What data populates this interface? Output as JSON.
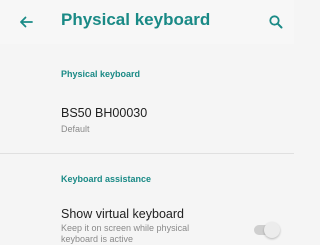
{
  "colors": {
    "accent": "#1a8a86",
    "background": "#f5f5f5",
    "primary_text": "#212121",
    "secondary_text": "#8a8a8a",
    "divider": "#e0e0e0"
  },
  "appbar": {
    "back_icon": "arrow-back-icon",
    "title": "Physical keyboard",
    "search_icon": "search-icon"
  },
  "sections": {
    "physical": {
      "header": "Physical keyboard",
      "device": {
        "title": "BS50 BH00030",
        "summary": "Default"
      }
    },
    "assistance": {
      "header": "Keyboard assistance",
      "show_virtual": {
        "title": "Show virtual keyboard",
        "summary_line1": "Keep it on screen while physical",
        "summary_line2": "keyboard is active",
        "enabled": false
      }
    }
  }
}
